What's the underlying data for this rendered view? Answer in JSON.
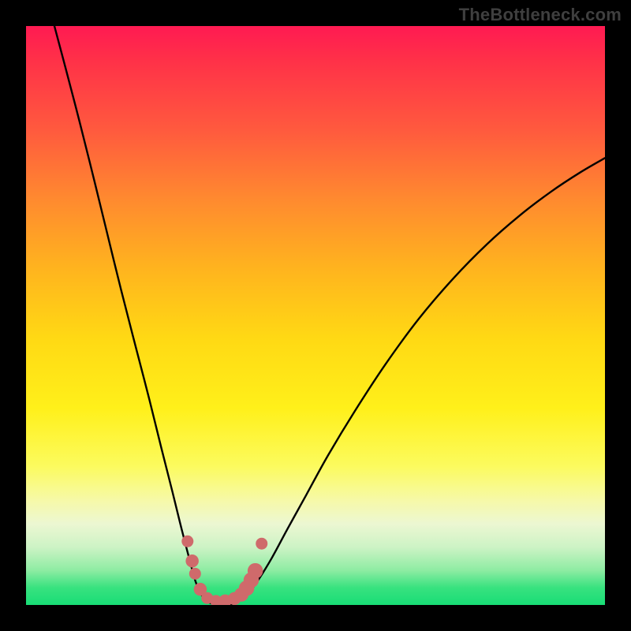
{
  "watermark": "TheBottleneck.com",
  "colors": {
    "background": "#000000",
    "curve": "#000000",
    "datapoints": "#cf6a6b",
    "gradient_top": "#ff1a52",
    "gradient_bottom": "#18dd76"
  },
  "chart_data": {
    "type": "line",
    "title": "",
    "xlabel": "",
    "ylabel": "",
    "xlim": [
      0,
      100
    ],
    "ylim": [
      0,
      100
    ],
    "note": "No axis ticks are drawn; x and y are in percent of the plot area (0 = left/bottom, 100 = right/top).",
    "curve": [
      {
        "x": 4.9,
        "y": 100.0
      },
      {
        "x": 6.5,
        "y": 94.0
      },
      {
        "x": 8.6,
        "y": 86.0
      },
      {
        "x": 11.0,
        "y": 76.5
      },
      {
        "x": 13.7,
        "y": 65.5
      },
      {
        "x": 16.4,
        "y": 54.5
      },
      {
        "x": 19.1,
        "y": 44.0
      },
      {
        "x": 21.3,
        "y": 35.5
      },
      {
        "x": 23.4,
        "y": 27.0
      },
      {
        "x": 25.3,
        "y": 19.5
      },
      {
        "x": 26.9,
        "y": 13.0
      },
      {
        "x": 28.2,
        "y": 8.0
      },
      {
        "x": 29.3,
        "y": 4.0
      },
      {
        "x": 30.4,
        "y": 1.6
      },
      {
        "x": 31.5,
        "y": 0.5
      },
      {
        "x": 33.1,
        "y": 0.0
      },
      {
        "x": 34.9,
        "y": 0.0
      },
      {
        "x": 36.8,
        "y": 0.7
      },
      {
        "x": 38.4,
        "y": 2.0
      },
      {
        "x": 40.3,
        "y": 4.6
      },
      {
        "x": 42.5,
        "y": 8.2
      },
      {
        "x": 45.2,
        "y": 13.2
      },
      {
        "x": 48.4,
        "y": 19.0
      },
      {
        "x": 52.2,
        "y": 25.9
      },
      {
        "x": 56.8,
        "y": 33.5
      },
      {
        "x": 62.1,
        "y": 41.6
      },
      {
        "x": 67.9,
        "y": 49.5
      },
      {
        "x": 73.8,
        "y": 56.4
      },
      {
        "x": 79.6,
        "y": 62.3
      },
      {
        "x": 85.3,
        "y": 67.3
      },
      {
        "x": 90.7,
        "y": 71.4
      },
      {
        "x": 95.7,
        "y": 74.7
      },
      {
        "x": 100.0,
        "y": 77.2
      }
    ],
    "datapoints": [
      {
        "x": 27.9,
        "y": 11.0,
        "r": 1.0
      },
      {
        "x": 28.7,
        "y": 7.6,
        "r": 1.1
      },
      {
        "x": 29.2,
        "y": 5.4,
        "r": 1.0
      },
      {
        "x": 30.1,
        "y": 2.7,
        "r": 1.1
      },
      {
        "x": 31.3,
        "y": 1.2,
        "r": 1.0
      },
      {
        "x": 32.8,
        "y": 0.7,
        "r": 1.0
      },
      {
        "x": 34.4,
        "y": 0.7,
        "r": 1.1
      },
      {
        "x": 36.0,
        "y": 1.1,
        "r": 1.1
      },
      {
        "x": 37.2,
        "y": 1.8,
        "r": 1.2
      },
      {
        "x": 38.1,
        "y": 2.9,
        "r": 1.3
      },
      {
        "x": 38.9,
        "y": 4.3,
        "r": 1.3
      },
      {
        "x": 39.6,
        "y": 5.9,
        "r": 1.3
      },
      {
        "x": 40.7,
        "y": 10.6,
        "r": 1.0
      }
    ]
  }
}
